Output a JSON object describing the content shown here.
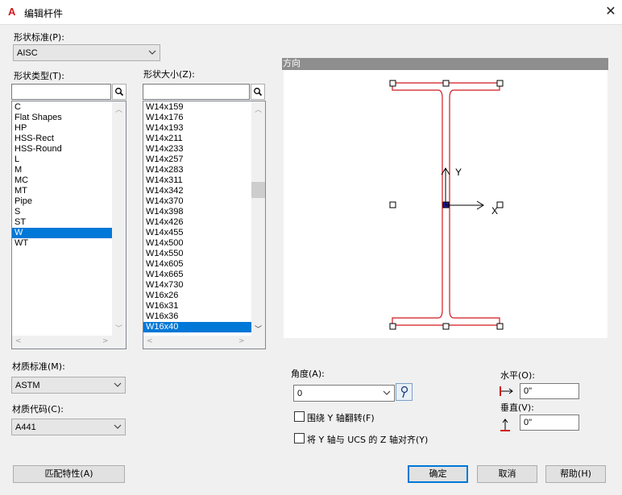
{
  "window": {
    "icon_letter": "A",
    "title": "编辑杆件",
    "close": "✕"
  },
  "shape_standard": {
    "label": "形状标准(P):",
    "value": "AISC"
  },
  "shape_type": {
    "label": "形状类型(T):",
    "search_value": "",
    "items": [
      "C",
      "Flat Shapes",
      "HP",
      "HSS-Rect",
      "HSS-Round",
      "L",
      "M",
      "MC",
      "MT",
      "Pipe",
      "S",
      "ST",
      "W",
      "WT"
    ],
    "selected": "W"
  },
  "shape_size": {
    "label": "形状大小(Z):",
    "search_value": "",
    "items": [
      "W14x159",
      "W14x176",
      "W14x193",
      "W14x211",
      "W14x233",
      "W14x257",
      "W14x283",
      "W14x311",
      "W14x342",
      "W14x370",
      "W14x398",
      "W14x426",
      "W14x455",
      "W14x500",
      "W14x550",
      "W14x605",
      "W14x665",
      "W14x730",
      "W16x26",
      "W16x31",
      "W16x36",
      "W16x40"
    ],
    "selected": "W16x40"
  },
  "orientation": {
    "header": "方向",
    "axis_y": "Y",
    "axis_x": "X"
  },
  "material_standard": {
    "label": "材质标准(M):",
    "value": "ASTM"
  },
  "material_code": {
    "label": "材质代码(C):",
    "value": "A441"
  },
  "angle": {
    "label": "角度(A):",
    "value": "0"
  },
  "horizontal": {
    "label": "水平(O):",
    "value": "0\""
  },
  "vertical": {
    "label": "垂直(V):",
    "value": "0\""
  },
  "checkboxes": {
    "flip_y": "围绕 Y 轴翻转(F)",
    "align_y_ucs": "将 Y 轴与 UCS 的 Z 轴对齐(Y)"
  },
  "buttons": {
    "match": "匹配特性(A)",
    "ok": "确定",
    "cancel": "取消",
    "help": "帮助(H)"
  },
  "colors": {
    "accent": "#0078d7",
    "beam_outline": "#d0181f",
    "grip": "#1a1aa0"
  }
}
